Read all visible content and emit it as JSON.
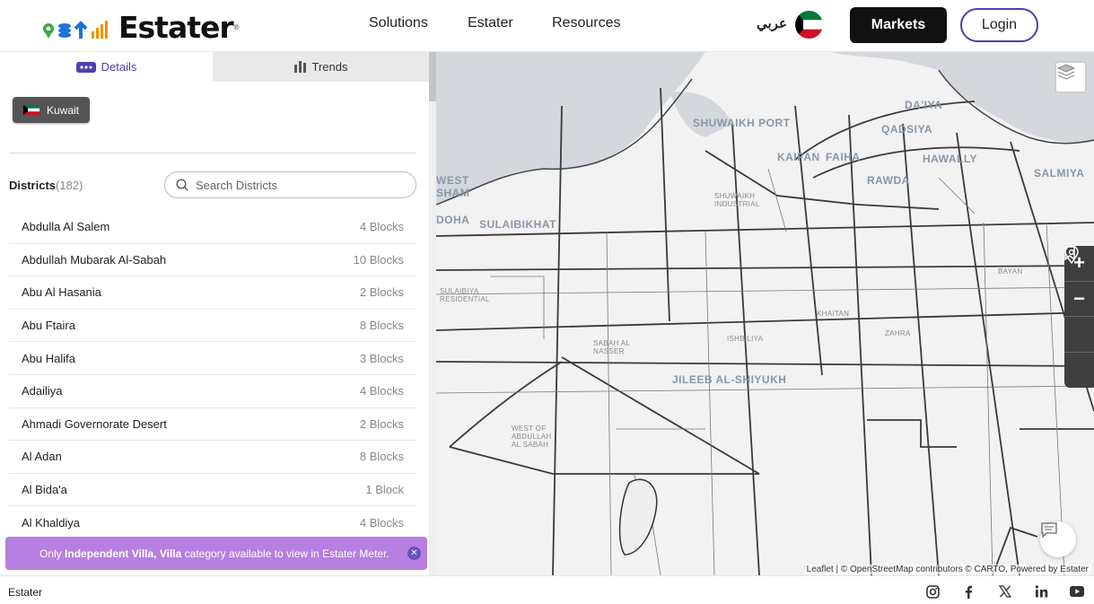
{
  "header": {
    "logo_text": "Estater",
    "nav": [
      "Solutions",
      "Estater",
      "Resources"
    ],
    "language_toggle": "عربي",
    "markets_label": "Markets",
    "login_label": "Login"
  },
  "panel": {
    "tabs": [
      {
        "label": "Details",
        "active": true
      },
      {
        "label": "Trends",
        "active": false
      }
    ],
    "country": "Kuwait",
    "districts_label": "Districts",
    "districts_count": "(182)",
    "search_placeholder": "Search Districts",
    "districts": [
      {
        "name": "Abdulla Al Salem",
        "blocks": "4 Blocks"
      },
      {
        "name": "Abdullah Mubarak Al-Sabah",
        "blocks": "10 Blocks"
      },
      {
        "name": "Abu Al Hasania",
        "blocks": "2 Blocks"
      },
      {
        "name": "Abu Ftaira",
        "blocks": "8 Blocks"
      },
      {
        "name": "Abu Halifa",
        "blocks": "3 Blocks"
      },
      {
        "name": "Adailiya",
        "blocks": "4 Blocks"
      },
      {
        "name": "Ahmadi Governorate Desert",
        "blocks": "2 Blocks"
      },
      {
        "name": "Al Adan",
        "blocks": "8 Blocks"
      },
      {
        "name": "Al Bida'a",
        "blocks": "1 Block"
      },
      {
        "name": "Al Khaldiya",
        "blocks": "4 Blocks"
      }
    ],
    "notice": {
      "prefix": "Only",
      "highlight": "Independent Villa, Villa",
      "suffix": "category available to view in Estater Meter."
    }
  },
  "map": {
    "labels": {
      "shuwaikh_port": "SHUWAIKH PORT",
      "daiya": "DA'IYA",
      "qadsiya": "QADSIYA",
      "kaifan": "KAIFAN",
      "faiha": "FAIHA",
      "hawally": "HAWALLY",
      "salmiya": "SALMIYA",
      "rawda": "RAWDA",
      "west_sham": "WEST SHAM",
      "doha": "DOHA",
      "sulaibikhat": "SULAIBIKHAT",
      "shuwaikh_industrial": "SHUWAIKH INDUSTRIAL",
      "bayan": "BAYAN",
      "sulaibiya_residential": "SULAIBIYA RESIDENTIAL",
      "khaitan": "KHAITAN",
      "zahra": "ZAHRA",
      "sabah_al_nasser": "SABAH AL NASSER",
      "ishbiliya": "ISHBILIYA",
      "jileeb": "JILEEB AL-SHIYUKH",
      "west_of_abdullah": "WEST OF ABDULLAH AL SABAH"
    },
    "controls": [
      "+",
      "−"
    ],
    "attribution": "Leaflet | © OpenStreetMap contributors © CARTO, Powered by Estater"
  },
  "footer": {
    "brand": "Estater",
    "social": [
      "instagram-icon",
      "facebook-icon",
      "x-icon",
      "linkedin-icon",
      "youtube-icon"
    ]
  }
}
